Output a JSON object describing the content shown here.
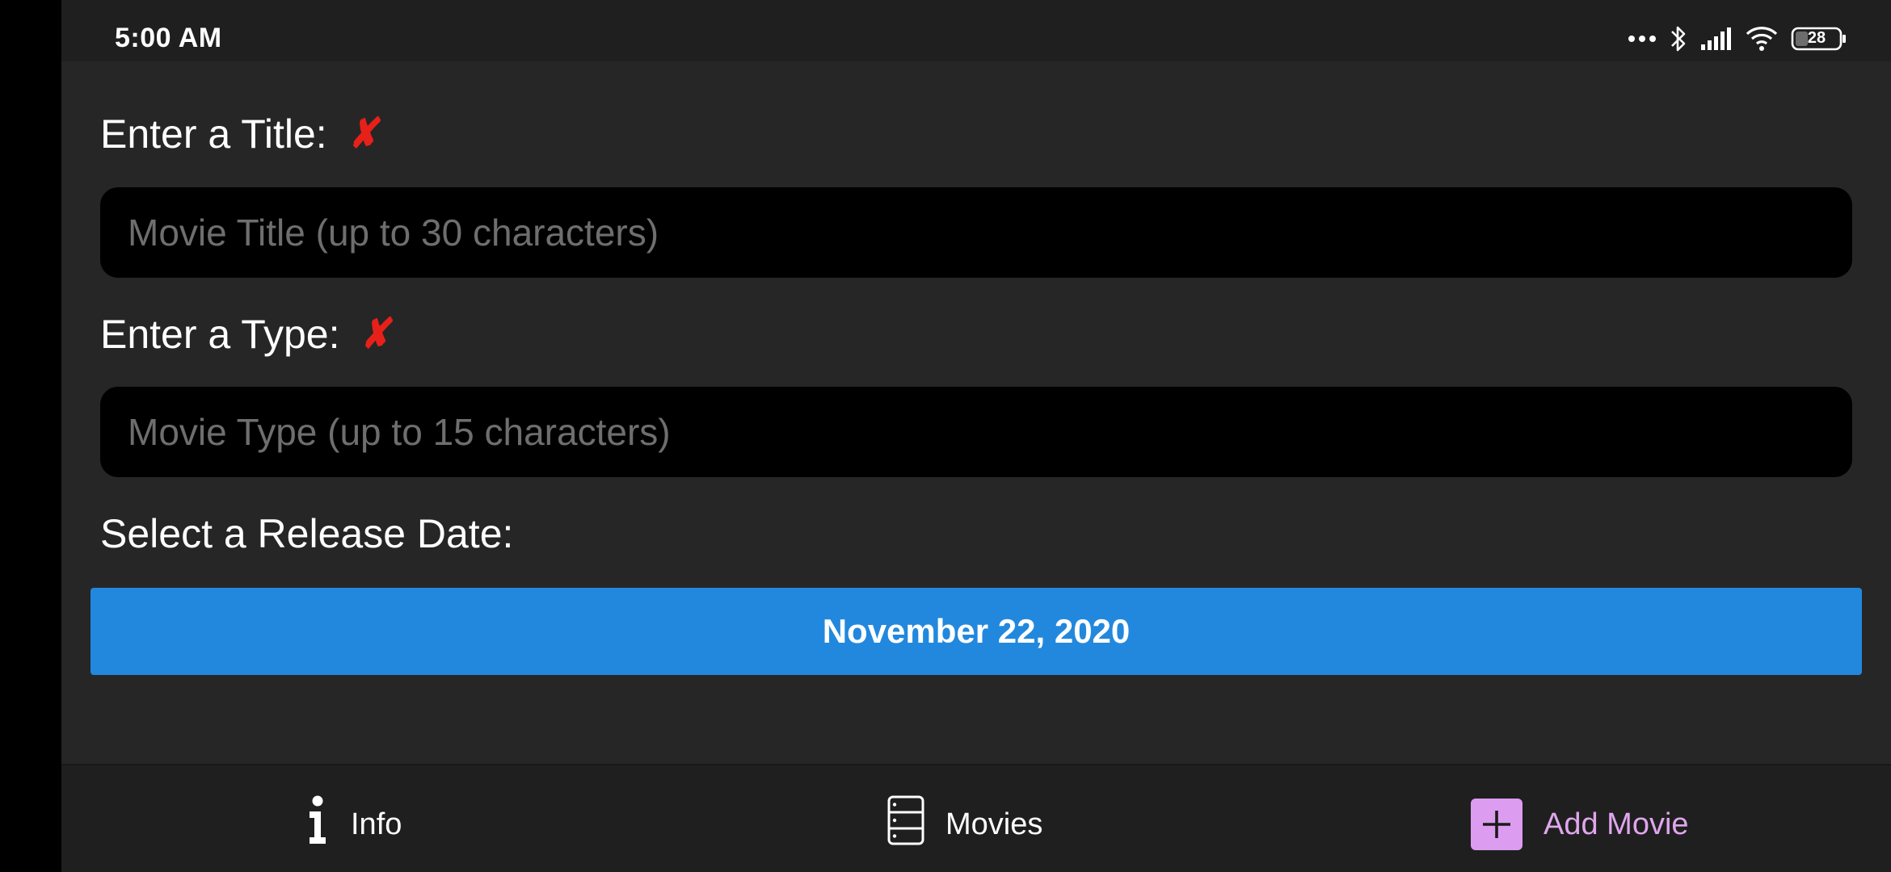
{
  "status_bar": {
    "time": "5:00 AM",
    "battery": "28",
    "icons": [
      "more-dots-icon",
      "bluetooth-icon",
      "signal-icon",
      "wifi-icon",
      "battery-icon"
    ]
  },
  "form": {
    "title_label": "Enter a Title:",
    "title_placeholder": "Movie Title (up to 30 characters)",
    "title_value": "",
    "type_label": "Enter a Type:",
    "type_placeholder": "Movie Type (up to 15 characters)",
    "type_value": "",
    "invalid_mark": "✘",
    "date_label": "Select a Release Date:",
    "date_value": "November 22, 2020"
  },
  "nav": {
    "info": "Info",
    "movies": "Movies",
    "add_movie": "Add Movie"
  },
  "colors": {
    "background": "#262626",
    "bars": "#1f1f1f",
    "accent_blue": "#2288dd",
    "invalid_red": "#e8201a",
    "active_tab": "#dc9cf0"
  }
}
